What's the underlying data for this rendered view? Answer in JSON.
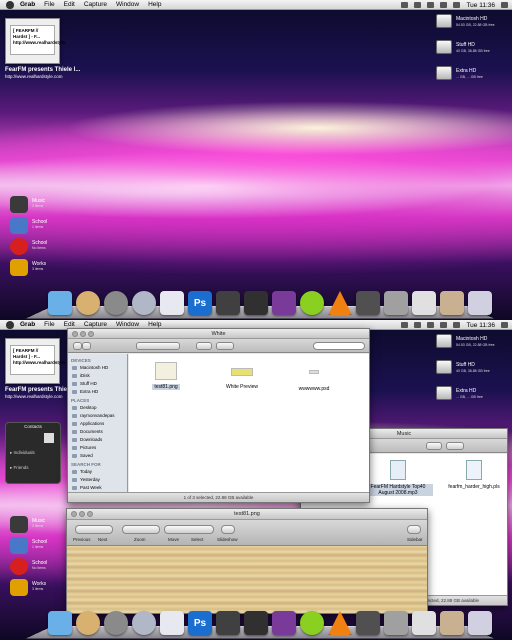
{
  "menubar": {
    "items": [
      "Grab",
      "File",
      "Edit",
      "Capture",
      "Window",
      "Help"
    ],
    "clock": "Tue 11:36"
  },
  "widget": {
    "lines": [
      "[ FEARFM // Hardst ] - F...",
      "http://www.realhardstyle."
    ],
    "caption": "FearFM presents Thiele l...",
    "url": "http://www.realhardstyle.com"
  },
  "drives": [
    {
      "name": "Macintosh HD",
      "sub": "54.53 GB, 22.88 GB free"
    },
    {
      "name": "Stuff HD",
      "sub": "40 GB, 36.88 GB free"
    },
    {
      "name": "Extra HD",
      "sub": "... GB, ... GB free"
    }
  ],
  "stacks": [
    {
      "name": "Music",
      "sub": "2 items",
      "color": "#3a3a3a"
    },
    {
      "name": "School",
      "sub": "1 items",
      "color": "#4a78c8"
    },
    {
      "name": "School",
      "sub": "No items",
      "color": "#d62020"
    },
    {
      "name": "Works",
      "sub": "3 items",
      "color": "#e0a000"
    }
  ],
  "dock": {
    "icons": [
      {
        "name": "finder-bear-icon",
        "color": "#6ab0e8",
        "glyph": ""
      },
      {
        "name": "clock-icon",
        "color": "#d8b070",
        "glyph": ""
      },
      {
        "name": "system-preferences-icon",
        "color": "#8a8a8a",
        "glyph": ""
      },
      {
        "name": "safari-icon",
        "color": "#b0b8c8",
        "glyph": ""
      },
      {
        "name": "robot-icon",
        "color": "#e8e8f0",
        "glyph": ""
      },
      {
        "name": "photoshop-icon",
        "color": "#1a6ed0",
        "glyph": "Ps"
      },
      {
        "name": "headphones-icon",
        "color": "#404040",
        "glyph": ""
      },
      {
        "name": "camera-icon",
        "color": "#303030",
        "glyph": ""
      },
      {
        "name": "book-icon",
        "color": "#7a3a9a",
        "glyph": ""
      },
      {
        "name": "lime-icon",
        "color": "#8ad020",
        "glyph": ""
      },
      {
        "name": "vlc-cone-icon",
        "color": "#f08010",
        "glyph": ""
      },
      {
        "name": "activity-monitor-icon",
        "color": "#505050",
        "glyph": ""
      },
      {
        "name": "utilities-icon",
        "color": "#a0a0a0",
        "glyph": ""
      },
      {
        "name": "gift-icon",
        "color": "#e0e0e0",
        "glyph": ""
      },
      {
        "name": "stacks-icon",
        "color": "#c8b090",
        "glyph": ""
      },
      {
        "name": "trash-icon",
        "color": "#d0d0e0",
        "glyph": ""
      }
    ]
  },
  "finder": {
    "title": "White",
    "sidebar": {
      "devices_header": "DEVICES",
      "devices": [
        "Macintosh HD",
        "iDisk",
        "Stuff HD",
        "Extra HD"
      ],
      "places_header": "PLACES",
      "places": [
        "Desktop",
        "raymonvandepas",
        "Applications",
        "Documents",
        "Downloads",
        "Pictures",
        "Saved"
      ],
      "search_header": "SEARCH FOR",
      "search": [
        "Today",
        "Yesterday",
        "Past Week"
      ]
    },
    "files": [
      {
        "label": "test81.png"
      },
      {
        "label": "White Preview"
      },
      {
        "label": "wwwwww.psd"
      }
    ],
    "status": "1 of 3 selected, 22.88 GB available"
  },
  "contacts": {
    "title": "Contacts",
    "groups": [
      "Individuals",
      "Friends"
    ]
  },
  "music_window": {
    "title": "Music",
    "files": [
      "FearFM Hardstyle Top40 August 2008.mp3",
      "fearfm_harder_high.pls"
    ],
    "status": "1 of 2 selected, 22.88 GB available"
  },
  "preview": {
    "title": "test81.png",
    "labels": [
      "Previous",
      "Next",
      "Zoom",
      "Move",
      "Select",
      "Slideshow",
      "Sidebar"
    ]
  }
}
